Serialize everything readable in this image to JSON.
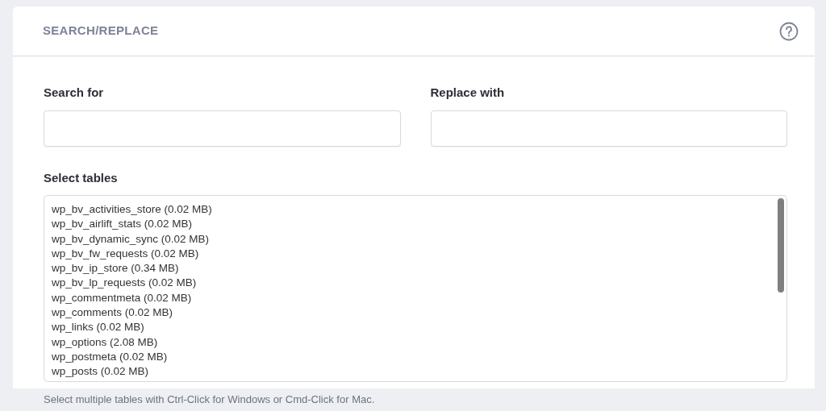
{
  "card": {
    "title": "SEARCH/REPLACE"
  },
  "fields": [
    {
      "label": "Search for"
    },
    {
      "label": "Replace with"
    }
  ],
  "tables": {
    "label": "Select tables",
    "items": [
      "wp_bv_activities_store (0.02 MB)",
      "wp_bv_airlift_stats (0.02 MB)",
      "wp_bv_dynamic_sync (0.02 MB)",
      "wp_bv_fw_requests (0.02 MB)",
      "wp_bv_ip_store (0.34 MB)",
      "wp_bv_lp_requests (0.02 MB)",
      "wp_commentmeta (0.02 MB)",
      "wp_comments (0.02 MB)",
      "wp_links (0.02 MB)",
      "wp_options (2.08 MB)",
      "wp_postmeta (0.02 MB)",
      "wp_posts (0.02 MB)"
    ],
    "help": "Select multiple tables with Ctrl-Click for Windows or Cmd-Click for Mac."
  }
}
